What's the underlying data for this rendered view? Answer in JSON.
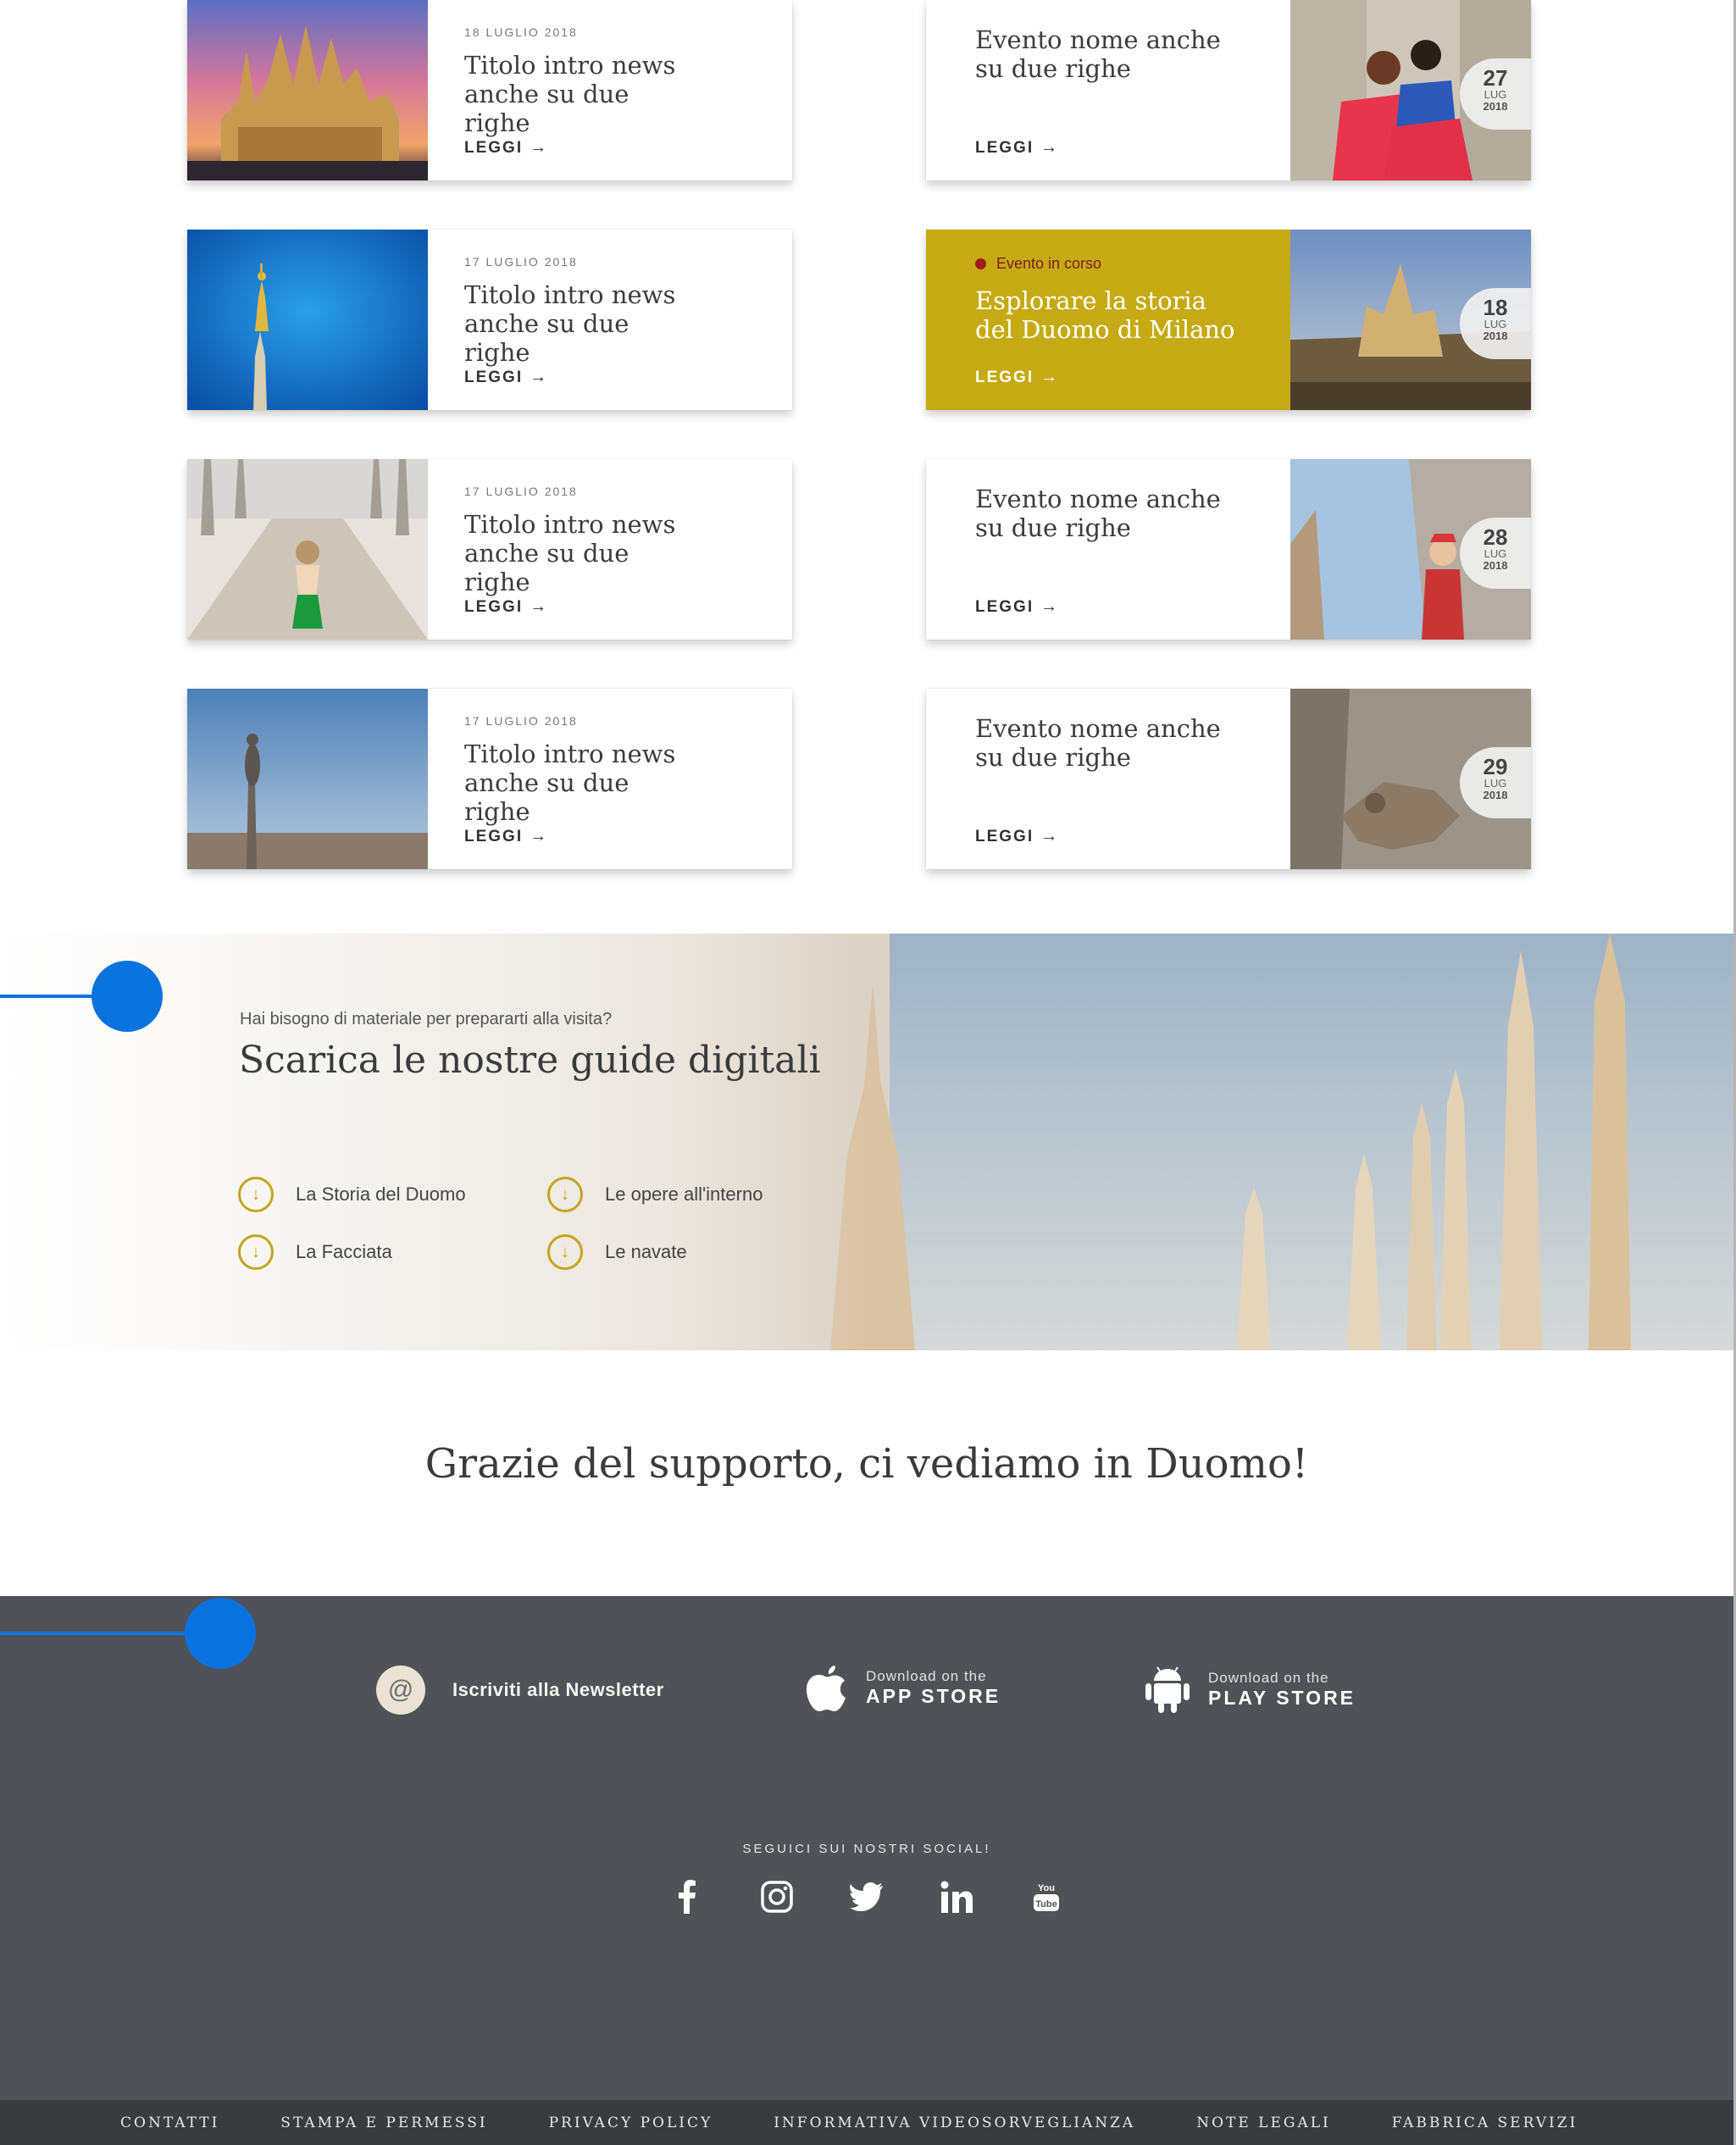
{
  "news": [
    {
      "date": "18 LUGLIO 2018",
      "title": "Titolo intro news anche su due righe",
      "cta": "LEGGI",
      "image": "duomo-sunset-photo"
    },
    {
      "date": "17 LUGLIO 2018",
      "title": "Titolo intro news anche su due righe",
      "cta": "LEGGI",
      "image": "madonnina-statue-photo"
    },
    {
      "date": "17 LUGLIO 2018",
      "title": "Titolo intro news anche su due righe",
      "cta": "LEGGI",
      "image": "rooftop-visitor-photo"
    },
    {
      "date": "17 LUGLIO 2018",
      "title": "Titolo intro news anche su due righe",
      "cta": "LEGGI",
      "image": "spire-statue-city-photo"
    }
  ],
  "events": [
    {
      "title": "Evento nome anche su due righe",
      "cta": "LEGGI",
      "day": "27",
      "month": "LUG",
      "year": "2018",
      "image": "girls-rooftop-photo"
    },
    {
      "status": "Evento in corso",
      "title": "Esplorare la storia del Duomo di Milano",
      "cta": "LEGGI",
      "day": "18",
      "month": "LUG",
      "year": "2018",
      "image": "duomo-aerial-photo"
    },
    {
      "title": "Evento nome anche su due righe",
      "cta": "LEGGI",
      "day": "28",
      "month": "LUG",
      "year": "2018",
      "image": "child-terrace-photo"
    },
    {
      "title": "Evento nome anche su due righe",
      "cta": "LEGGI",
      "day": "29",
      "month": "LUG",
      "year": "2018",
      "image": "gargoyle-photo"
    }
  ],
  "guides": {
    "kicker": "Hai bisogno di materiale per prepararti alla visita?",
    "heading": "Scarica le nostre guide digitali",
    "links": [
      "La Storia del Duomo",
      "La Facciata",
      "Le opere all'interno",
      "Le navate"
    ]
  },
  "thanks": "Grazie del supporto, ci vediamo in Duomo!",
  "footer": {
    "newsletter": "Iscriviti alla Newsletter",
    "app_store_small": "Download on the",
    "app_store_big": "APP STORE",
    "play_store_small": "Download on the",
    "play_store_big": "PLAY STORE",
    "social_title": "SEGUICI SUI NOSTRI SOCIAL!",
    "socials": [
      "facebook-icon",
      "instagram-icon",
      "twitter-icon",
      "linkedin-icon",
      "youtube-icon"
    ],
    "links": [
      "CONTATTI",
      "STAMPA E PERMESSI",
      "PRIVACY POLICY",
      "INFORMATIVA VIDEOSORVEGLIANZA",
      "NOTE LEGALI",
      "FABBRICA SERVIZI"
    ]
  },
  "colors": {
    "accent": "#c6aa13",
    "footer": "#4f5256",
    "footer_bar": "#393b3e",
    "marker": "#0a73e0",
    "live_dot": "#9e1b1b"
  }
}
